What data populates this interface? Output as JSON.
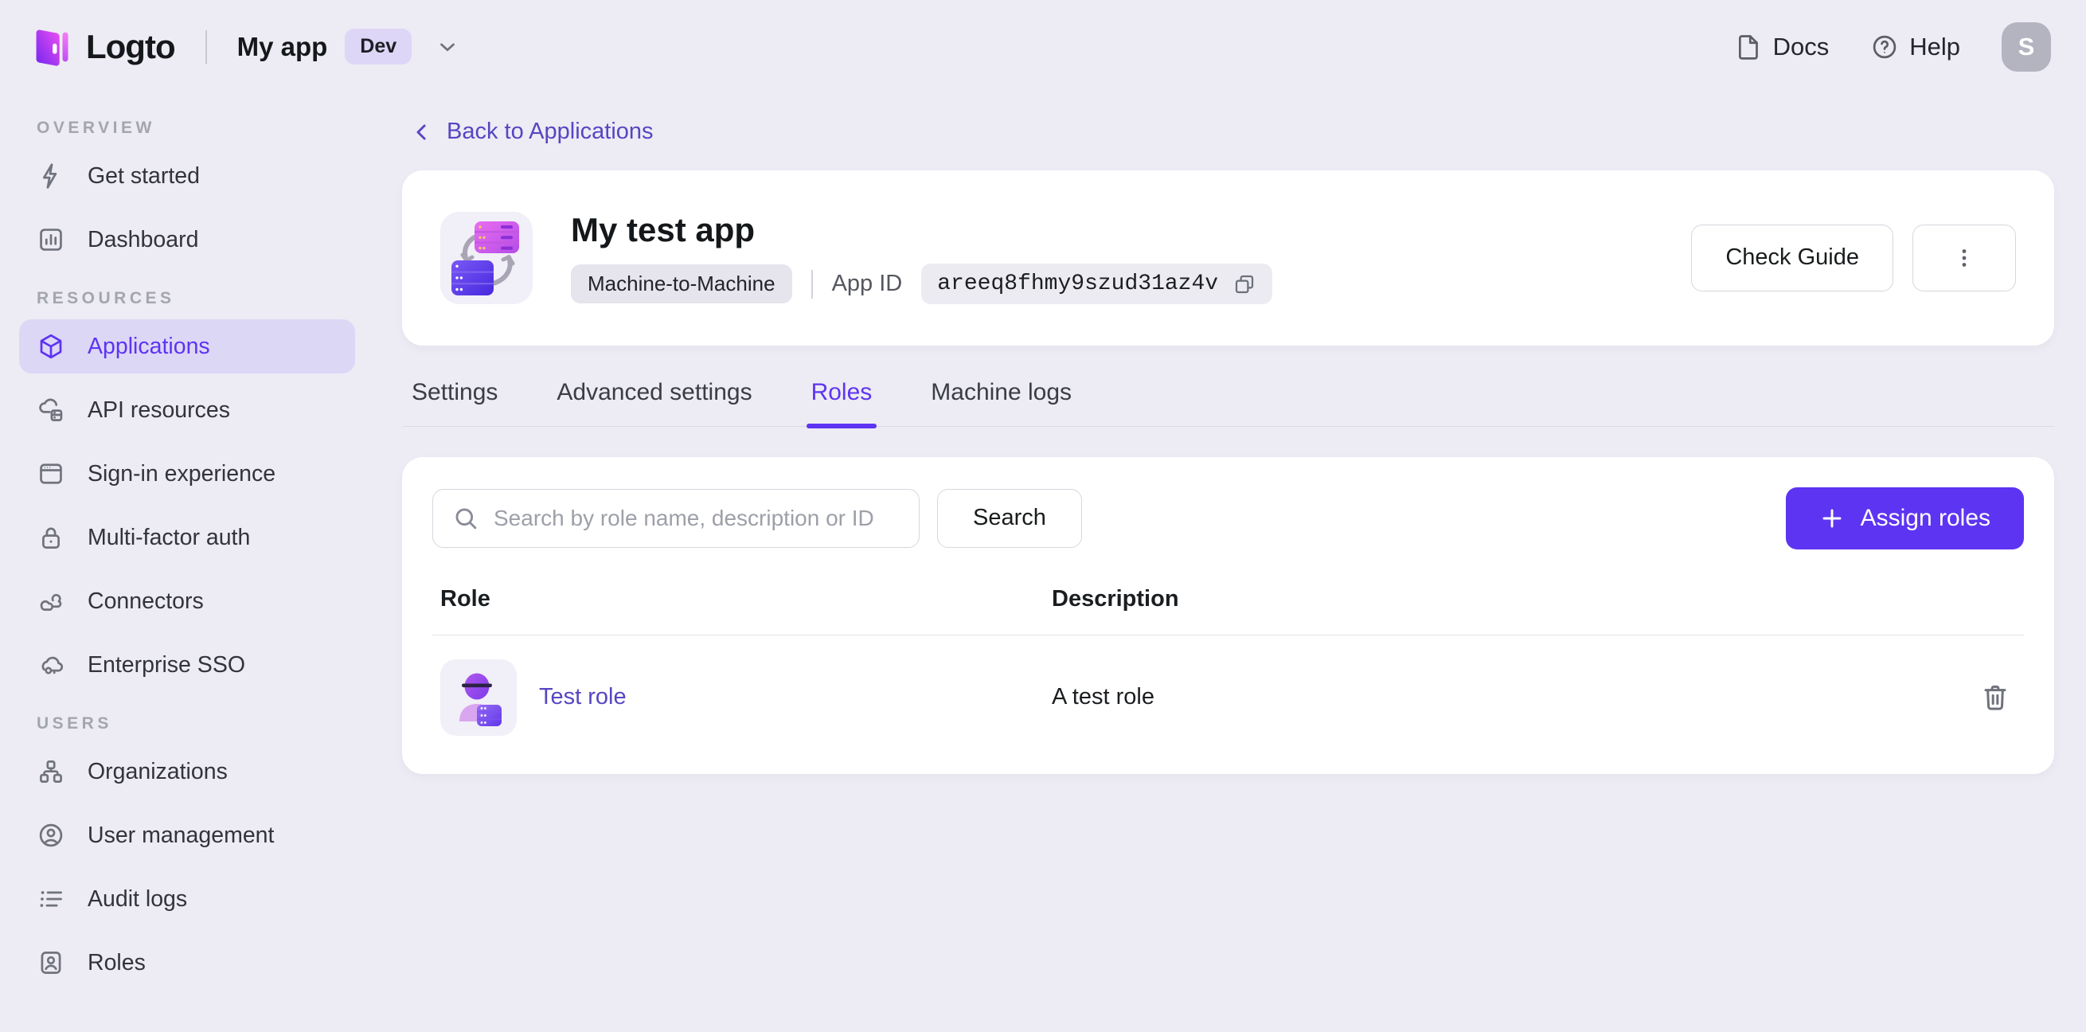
{
  "topbar": {
    "brand": "Logto",
    "app_switcher": {
      "name": "My app",
      "env_badge": "Dev"
    },
    "docs_label": "Docs",
    "help_label": "Help",
    "avatar_initial": "S"
  },
  "sidebar": {
    "sections": [
      {
        "label": "OVERVIEW",
        "items": [
          {
            "label": "Get started",
            "icon": "lightning-icon"
          },
          {
            "label": "Dashboard",
            "icon": "bar-chart-icon"
          }
        ]
      },
      {
        "label": "RESOURCES",
        "items": [
          {
            "label": "Applications",
            "icon": "cube-icon",
            "active": true
          },
          {
            "label": "API resources",
            "icon": "cloud-box-icon"
          },
          {
            "label": "Sign-in experience",
            "icon": "browser-icon"
          },
          {
            "label": "Multi-factor auth",
            "icon": "lock-icon"
          },
          {
            "label": "Connectors",
            "icon": "clouds-icon"
          },
          {
            "label": "Enterprise SSO",
            "icon": "cloud-key-icon"
          }
        ]
      },
      {
        "label": "USERS",
        "items": [
          {
            "label": "Organizations",
            "icon": "org-chart-icon"
          },
          {
            "label": "User management",
            "icon": "user-circle-icon"
          },
          {
            "label": "Audit logs",
            "icon": "list-icon"
          },
          {
            "label": "Roles",
            "icon": "id-card-icon"
          }
        ]
      }
    ]
  },
  "main": {
    "back_link": "Back to Applications",
    "app_card": {
      "title": "My test app",
      "type_badge": "Machine-to-Machine",
      "app_id_label": "App ID",
      "app_id_value": "areeq8fhmy9szud31az4v",
      "check_guide_label": "Check Guide"
    },
    "tabs": [
      {
        "label": "Settings"
      },
      {
        "label": "Advanced settings"
      },
      {
        "label": "Roles",
        "active": true
      },
      {
        "label": "Machine logs"
      }
    ],
    "roles_panel": {
      "search_placeholder": "Search by role name, description or ID",
      "search_button_label": "Search",
      "assign_button_label": "Assign roles",
      "table": {
        "columns": [
          "Role",
          "Description"
        ],
        "rows": [
          {
            "role": "Test role",
            "description": "A test role"
          }
        ]
      }
    }
  },
  "colors": {
    "page_bg": "#edebf4",
    "card_bg": "#ffffff",
    "accent": "#5d34f2",
    "accent_light_bg": "#ddd7f6",
    "link": "#5646c1",
    "badge_bg": "#e6e4ed",
    "code_bg": "#edebf2",
    "avatar_bg": "#b4b3c0"
  }
}
